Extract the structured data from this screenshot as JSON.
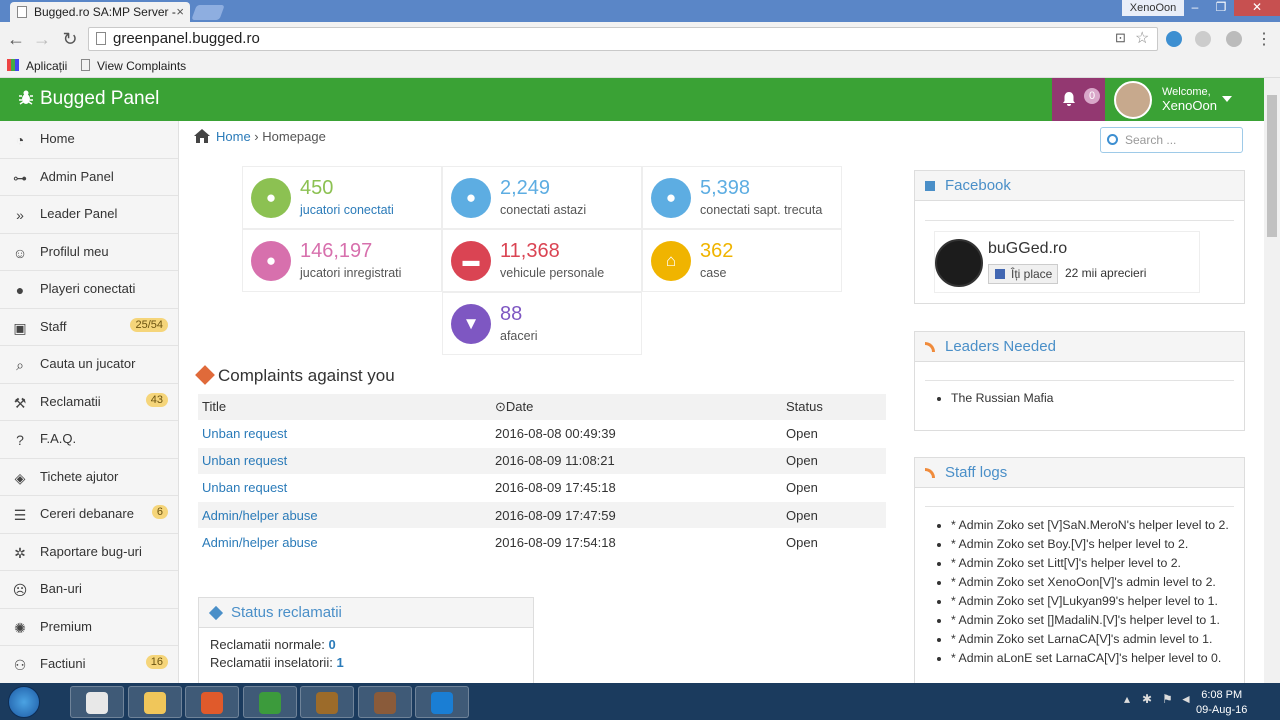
{
  "browser": {
    "tab_title": "Bugged.ro SA:MP Server -",
    "url": "greenpanel.bugged.ro",
    "profile_name": "XenoOon",
    "bookmarks": [
      {
        "label": "Aplicații",
        "icon": "apps-grid-icon"
      },
      {
        "label": "View Complaints",
        "icon": "page-icon"
      }
    ]
  },
  "header": {
    "brand": "Bugged Panel",
    "notifications": "0",
    "welcome_label": "Welcome,",
    "user_name": "XenoOon",
    "accent": "#3aa235"
  },
  "sidebar": {
    "items": [
      {
        "label": "Home",
        "icon": "dashboard-icon",
        "badge": ""
      },
      {
        "label": "Admin Panel",
        "icon": "sitemap-icon",
        "badge": ""
      },
      {
        "label": "Leader Panel",
        "icon": "double-chevron-icon",
        "badge": ""
      },
      {
        "label": "Profilul meu",
        "icon": "smile-icon",
        "badge": ""
      },
      {
        "label": "Playeri conectati",
        "icon": "user-icon",
        "badge": ""
      },
      {
        "label": "Staff",
        "icon": "android-icon",
        "badge": "25/54"
      },
      {
        "label": "Cauta un jucator",
        "icon": "search-icon",
        "badge": ""
      },
      {
        "label": "Reclamatii",
        "icon": "gavel-icon",
        "badge": "43"
      },
      {
        "label": "F.A.Q.",
        "icon": "question-icon",
        "badge": ""
      },
      {
        "label": "Tichete ajutor",
        "icon": "ticket-icon",
        "badge": ""
      },
      {
        "label": "Cereri debanare",
        "icon": "list-icon",
        "badge": "6"
      },
      {
        "label": "Raportare bug-uri",
        "icon": "bug-icon",
        "badge": ""
      },
      {
        "label": "Ban-uri",
        "icon": "frown-icon",
        "badge": ""
      },
      {
        "label": "Premium",
        "icon": "certificate-icon",
        "badge": ""
      },
      {
        "label": "Factiuni",
        "icon": "users-icon",
        "badge": "16"
      }
    ]
  },
  "breadcrumb": {
    "home": "Home",
    "current": "Homepage"
  },
  "search": {
    "placeholder": "Search ..."
  },
  "stats": [
    {
      "value": "450",
      "label": "jucatori conectati",
      "color": "#8cc152",
      "icon": "user-icon"
    },
    {
      "value": "2,249",
      "label": "conectati astazi",
      "color": "#5dade2",
      "icon": "user-icon"
    },
    {
      "value": "5,398",
      "label": "conectati sapt. trecuta",
      "color": "#5dade2",
      "icon": "user-icon"
    },
    {
      "value": "146,197",
      "label": "jucatori inregistrati",
      "color": "#d770ad",
      "icon": "user-icon"
    },
    {
      "value": "11,368",
      "label": "vehicule personale",
      "color": "#da4453",
      "icon": "truck-icon"
    },
    {
      "value": "362",
      "label": "case",
      "color": "#f0b400",
      "icon": "home-icon"
    },
    {
      "value": "88",
      "label": "afaceri",
      "color": "#7e57c2",
      "icon": "glass-icon"
    }
  ],
  "complaints": {
    "title": "Complaints against you",
    "columns": {
      "title": "Title",
      "date": "Date",
      "status": "Status"
    },
    "rows": [
      {
        "title": "Unban request",
        "date": "2016-08-08 00:49:39",
        "status": "Open"
      },
      {
        "title": "Unban request",
        "date": "2016-08-09 11:08:21",
        "status": "Open"
      },
      {
        "title": "Unban request",
        "date": "2016-08-09 17:45:18",
        "status": "Open"
      },
      {
        "title": "Admin/helper abuse",
        "date": "2016-08-09 17:47:59",
        "status": "Open"
      },
      {
        "title": "Admin/helper abuse",
        "date": "2016-08-09 17:54:18",
        "status": "Open"
      }
    ]
  },
  "status_box": {
    "title": "Status reclamatii",
    "rows": [
      {
        "label": "Reclamatii normale:",
        "value": "0"
      },
      {
        "label": "Reclamatii inselatorii:",
        "value": "1"
      }
    ]
  },
  "facebook": {
    "title": "Facebook",
    "page_name": "buGGed.ro",
    "like_label": "Îți place",
    "likes": "22 mii aprecieri"
  },
  "leaders": {
    "title": "Leaders Needed",
    "items": [
      "The Russian Mafia"
    ]
  },
  "staff_logs": {
    "title": "Staff logs",
    "items": [
      "* Admin Zoko set [V]SaN.MeroN's helper level to 2.",
      "* Admin Zoko set Boy.[V]'s helper level to 2.",
      "* Admin Zoko set Litt[V]'s helper level to 2.",
      "* Admin Zoko set XenoOon[V]'s admin level to 2.",
      "* Admin Zoko set [V]Lukyan99's helper level to 1.",
      "* Admin Zoko set []MadaliN.[V]'s helper level to 1.",
      "* Admin Zoko set LarnaCA[V]'s admin level to 1.",
      "* Admin aLonE set LarnaCA[V]'s helper level to 0."
    ]
  },
  "taskbar": {
    "time": "6:08 PM",
    "date": "09-Aug-16",
    "apps": [
      "file-manager-icon",
      "explorer-icon",
      "media-player-icon",
      "chrome-icon",
      "winrar-icon",
      "samp-icon",
      "teamviewer-icon"
    ]
  }
}
